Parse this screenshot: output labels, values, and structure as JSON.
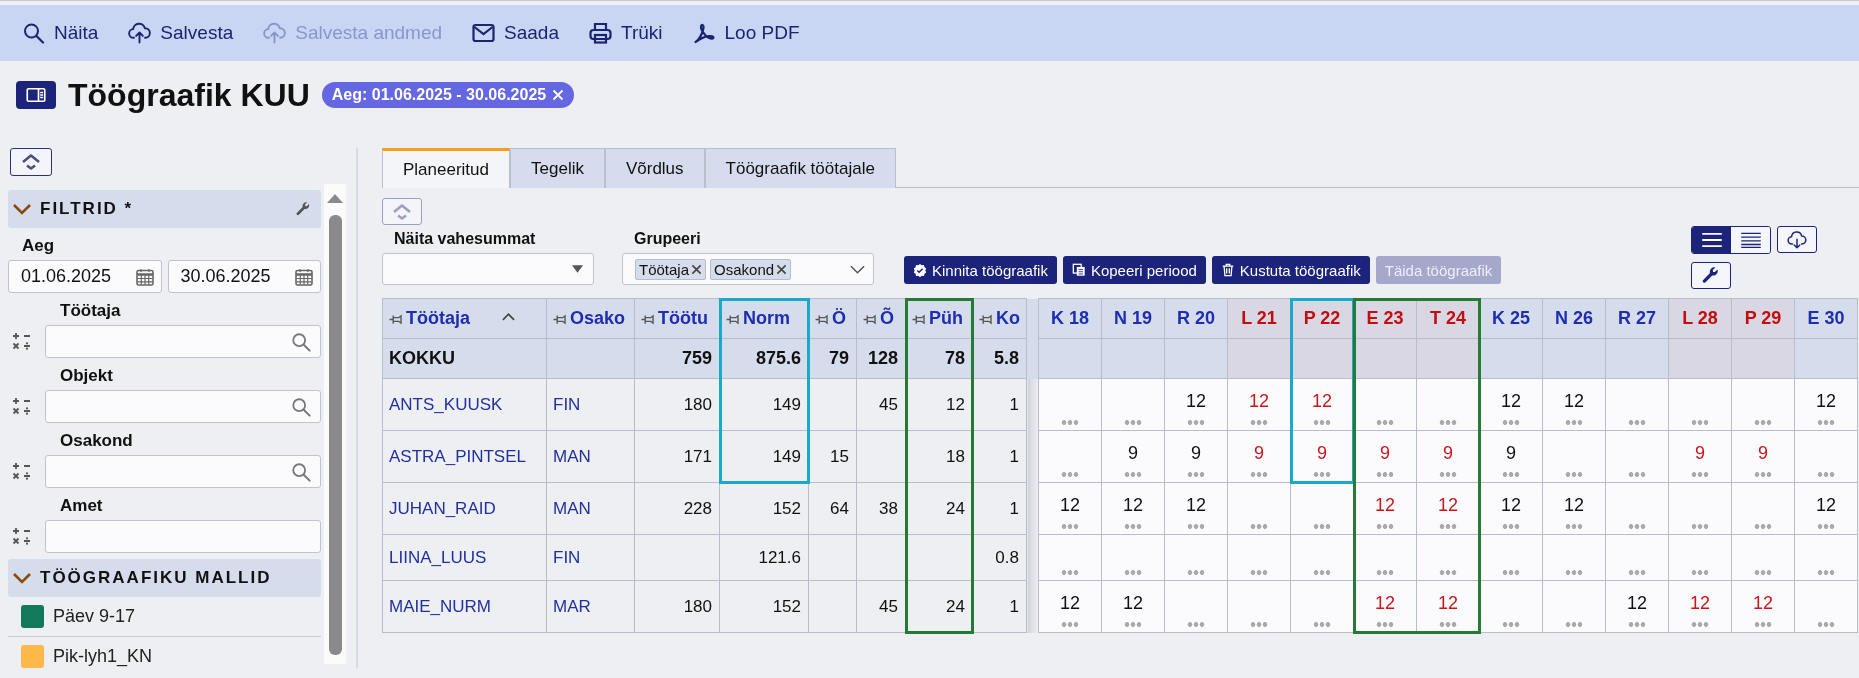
{
  "toolbar": [
    {
      "label": "Näita",
      "disabled": false
    },
    {
      "label": "Salvesta",
      "disabled": false
    },
    {
      "label": "Salvesta andmed",
      "disabled": true
    },
    {
      "label": "Saada",
      "disabled": false
    },
    {
      "label": "Trüki",
      "disabled": false
    },
    {
      "label": "Loo PDF",
      "disabled": false
    }
  ],
  "page_title": "Töögraafik KUU",
  "period_badge": "Aeg: 01.06.2025 - 30.06.2025",
  "sidebar": {
    "sections": [
      {
        "title": "FILTRID *",
        "kind": "filters",
        "expanded": true,
        "fields": [
          {
            "label": "Aeg",
            "kind": "date-range",
            "values": [
              "01.06.2025",
              "30.06.2025"
            ]
          },
          {
            "label": "Töötaja",
            "kind": "search"
          },
          {
            "label": "Objekt",
            "kind": "search"
          },
          {
            "label": "Osakond",
            "kind": "search"
          },
          {
            "label": "Amet",
            "kind": "text"
          }
        ]
      },
      {
        "title": "TÖÖGRAAFIKU MALLID",
        "kind": "templates",
        "expanded": true,
        "items": [
          {
            "label": "Päev 9-17",
            "color": "#13795b"
          },
          {
            "label": "Pik-lyh1_KN",
            "color": "#fdb84a"
          }
        ]
      }
    ]
  },
  "tabs": [
    {
      "label": "Planeeritud",
      "selected": true
    },
    {
      "label": "Tegelik",
      "selected": false
    },
    {
      "label": "Võrdlus",
      "selected": false
    },
    {
      "label": "Töögraafik töötajale",
      "selected": false
    }
  ],
  "subtotal": {
    "label": "Näita vahesummat"
  },
  "grouping": {
    "label": "Grupeeri",
    "chips": [
      "Töötaja",
      "Osakond"
    ]
  },
  "actions": [
    {
      "label": "Kinnita töögraafik",
      "disabled": false
    },
    {
      "label": "Kopeeri periood",
      "disabled": false
    },
    {
      "label": "Kustuta töögraafik",
      "disabled": false
    },
    {
      "label": "Täida töögraafik",
      "disabled": true
    }
  ],
  "view_modes": [
    {
      "kind": "compact",
      "selected": true
    },
    {
      "kind": "detailed",
      "selected": false
    }
  ],
  "table": {
    "columns": [
      {
        "label": "Töötaja",
        "kind": "link",
        "sorted": true
      },
      {
        "label": "Osako",
        "kind": "link"
      },
      {
        "label": "Töötu",
        "kind": "number"
      },
      {
        "label": "Norm",
        "kind": "number",
        "outline": {
          "color": "#1aa9cb"
        }
      },
      {
        "label": "Ö",
        "kind": "number"
      },
      {
        "label": "Õ",
        "kind": "number"
      },
      {
        "label": "Püh",
        "kind": "number",
        "outline": {
          "color": "#267a33"
        }
      },
      {
        "label": "Ko",
        "kind": "number"
      }
    ],
    "day_columns": [
      {
        "label": "K 18",
        "holiday": false
      },
      {
        "label": "N 19",
        "holiday": false
      },
      {
        "label": "R 20",
        "holiday": false
      },
      {
        "label": "L 21",
        "holiday": true
      },
      {
        "label": "P 22",
        "holiday": true,
        "outline": {
          "color": "#1aa9cb"
        }
      },
      {
        "label": "E 23",
        "holiday": true,
        "outline": {
          "color": "#267a33"
        }
      },
      {
        "label": "T 24",
        "holiday": true,
        "outline": {
          "color": "#267a33"
        }
      },
      {
        "label": "K 25",
        "holiday": false
      },
      {
        "label": "N 26",
        "holiday": false
      },
      {
        "label": "R 27",
        "holiday": false
      },
      {
        "label": "L 28",
        "holiday": true
      },
      {
        "label": "P 29",
        "holiday": true
      },
      {
        "label": "E 30",
        "holiday": false
      }
    ],
    "total_row": {
      "employee": "KOKKU",
      "column_3": "759",
      "column_4": "875.6",
      "column_5": "79",
      "column_6": "128",
      "column_7": "78",
      "column_8": "5.8"
    },
    "rows": [
      {
        "employee": "ANTS_KUUSK",
        "department": "FIN",
        "column_3": "180",
        "column_4": "149",
        "column_6": "45",
        "column_7": "12",
        "column_8": "1",
        "outlines": [
          {
            "color": "#1aa9cb"
          },
          {
            "color": "#267a33"
          }
        ],
        "days": {
          "day_3": "12",
          "day_4": "12",
          "day_5": "12",
          "day_8": "12",
          "day_9": "12",
          "day_13": "12"
        }
      },
      {
        "employee": "ASTRA_PINTSEL",
        "department": "MAN",
        "column_3": "171",
        "column_4": "149",
        "column_5": "15",
        "column_7": "18",
        "column_8": "1",
        "outlines": [
          {
            "color": "#1aa9cb"
          },
          {
            "color": "#267a33"
          }
        ],
        "days": {
          "day_2": "9",
          "day_3": "9",
          "day_4": "9",
          "day_5": "9",
          "day_6": "9",
          "day_7": "9",
          "day_8": "9",
          "day_11": "9",
          "day_12": "9"
        }
      },
      {
        "employee": "JUHAN_RAID",
        "department": "MAN",
        "column_3": "228",
        "column_4": "152",
        "column_5": "64",
        "column_6": "38",
        "column_7": "24",
        "column_8": "1",
        "outlines": [
          {
            "color": "#267a33"
          }
        ],
        "days": {
          "day_1": "12",
          "day_2": "12",
          "day_3": "12",
          "day_6": "12",
          "day_7": "12",
          "day_8": "12",
          "day_9": "12",
          "day_13": "12"
        }
      },
      {
        "employee": "LIINA_LUUS",
        "department": "FIN",
        "column_4": "121.6",
        "column_8": "0.8",
        "outlines": [
          {
            "color": "#267a33"
          }
        ]
      },
      {
        "employee": "MAIE_NURM",
        "department": "MAR",
        "column_3": "180",
        "column_4": "152",
        "column_6": "45",
        "column_7": "24",
        "column_8": "1",
        "outlines": [
          {
            "color": "#267a33"
          }
        ],
        "days": {
          "day_1": "12",
          "day_2": "12",
          "day_6": "12",
          "day_7": "12",
          "day_10": "12",
          "day_11": "12",
          "day_12": "12"
        }
      }
    ]
  }
}
